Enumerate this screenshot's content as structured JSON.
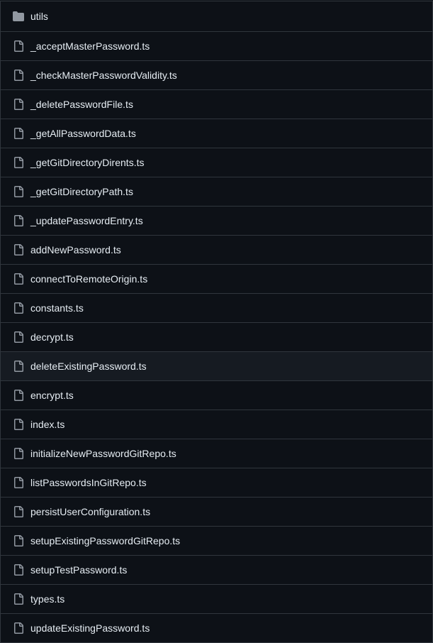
{
  "colors": {
    "background": "#0d1117",
    "border": "#30363d",
    "text": "#e6edf3",
    "icon": "#9198a1",
    "hover_row": "#161b22"
  },
  "files": [
    {
      "name": "utils",
      "type": "folder"
    },
    {
      "name": "_acceptMasterPassword.ts",
      "type": "file"
    },
    {
      "name": "_checkMasterPasswordValidity.ts",
      "type": "file"
    },
    {
      "name": "_deletePasswordFile.ts",
      "type": "file"
    },
    {
      "name": "_getAllPasswordData.ts",
      "type": "file"
    },
    {
      "name": "_getGitDirectoryDirents.ts",
      "type": "file"
    },
    {
      "name": "_getGitDirectoryPath.ts",
      "type": "file"
    },
    {
      "name": "_updatePasswordEntry.ts",
      "type": "file"
    },
    {
      "name": "addNewPassword.ts",
      "type": "file"
    },
    {
      "name": "connectToRemoteOrigin.ts",
      "type": "file"
    },
    {
      "name": "constants.ts",
      "type": "file"
    },
    {
      "name": "decrypt.ts",
      "type": "file"
    },
    {
      "name": "deleteExistingPassword.ts",
      "type": "file",
      "hovered": true
    },
    {
      "name": "encrypt.ts",
      "type": "file"
    },
    {
      "name": "index.ts",
      "type": "file"
    },
    {
      "name": "initializeNewPasswordGitRepo.ts",
      "type": "file"
    },
    {
      "name": "listPasswordsInGitRepo.ts",
      "type": "file"
    },
    {
      "name": "persistUserConfiguration.ts",
      "type": "file"
    },
    {
      "name": "setupExistingPasswordGitRepo.ts",
      "type": "file"
    },
    {
      "name": "setupTestPassword.ts",
      "type": "file"
    },
    {
      "name": "types.ts",
      "type": "file"
    },
    {
      "name": "updateExistingPassword.ts",
      "type": "file"
    }
  ]
}
